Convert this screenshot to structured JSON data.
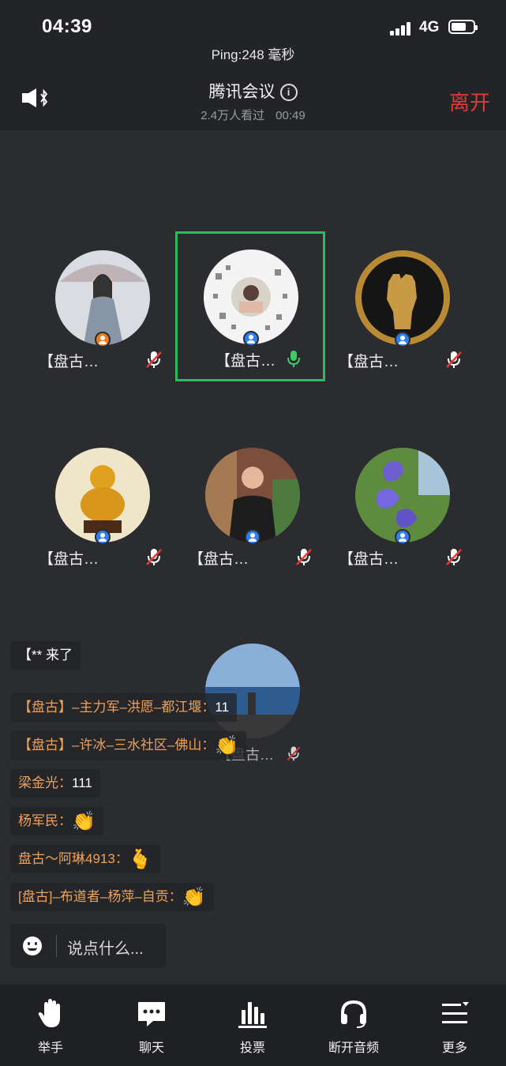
{
  "status_bar": {
    "time": "04:39",
    "network": "4G",
    "ping": "Ping:248 毫秒"
  },
  "header": {
    "title": "腾讯会议",
    "viewers": "2.4万人看过",
    "duration": "00:49",
    "leave_label": "离开"
  },
  "participants": [
    {
      "name": "【盘古…",
      "mic": "muted",
      "badge": "orange",
      "avatar_icon": "woman-umbrella-avatar"
    },
    {
      "name": "【盘古…",
      "mic": "speaking",
      "badge": "blue",
      "avatar_icon": "qr-code-avatar",
      "active": true
    },
    {
      "name": "【盘古…",
      "mic": "muted",
      "badge": "blue",
      "avatar_icon": "raised-fist-avatar"
    },
    {
      "name": "【盘古…",
      "mic": "muted",
      "badge": "blue",
      "avatar_icon": "golden-gourd-avatar"
    },
    {
      "name": "【盘古…",
      "mic": "muted",
      "badge": "blue",
      "avatar_icon": "man-portrait-avatar"
    },
    {
      "name": "【盘古…",
      "mic": "muted",
      "badge": "blue",
      "avatar_icon": "purple-flower-avatar"
    }
  ],
  "floating_participant": {
    "name": "【盘古…",
    "mic": "muted",
    "avatar_icon": "seaside-avatar"
  },
  "chat": [
    {
      "name": "",
      "message": "【** 来了"
    },
    {
      "name": "【盘古】–主力军–洪愿–都江堰：",
      "message": "11"
    },
    {
      "name": "【盘古】–许冰–三水社区–佛山：",
      "message": "👏"
    },
    {
      "name": "梁金光：",
      "message": "111"
    },
    {
      "name": "杨军民：",
      "message": "👏"
    },
    {
      "name": "盘古～阿琳4913：",
      "message": "🫰"
    },
    {
      "name": "[盘古]–布道者–杨萍–自贡：",
      "message": "👏"
    }
  ],
  "chat_input": {
    "placeholder": "说点什么..."
  },
  "toolbar": [
    {
      "label": "举手",
      "icon": "raise-hand-icon"
    },
    {
      "label": "聊天",
      "icon": "chat-icon"
    },
    {
      "label": "投票",
      "icon": "vote-icon"
    },
    {
      "label": "断开音频",
      "icon": "headset-icon"
    },
    {
      "label": "更多",
      "icon": "more-menu-icon"
    }
  ],
  "colors": {
    "leave": "#e53935",
    "active_border": "#2fb85a",
    "chat_name": "#f0a159",
    "badge_blue": "#2d7ff0",
    "badge_orange": "#f07a1e"
  }
}
